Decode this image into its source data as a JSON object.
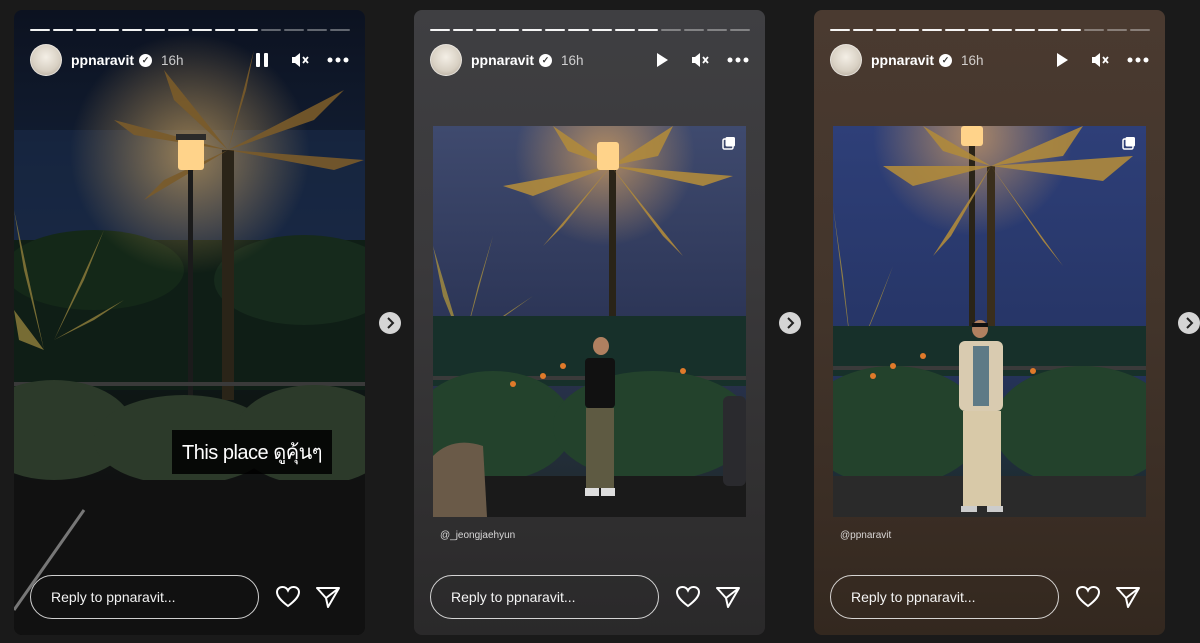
{
  "stories": [
    {
      "username": "ppnaravit",
      "time": "16h",
      "caption": "This place ดูคุ้นๆ",
      "reply_placeholder": "Reply to ppnaravit...",
      "playback": "paused"
    },
    {
      "username": "ppnaravit",
      "time": "16h",
      "mention": "@_jeongjaehyun",
      "reply_placeholder": "Reply to ppnaravit...",
      "playback": "playing"
    },
    {
      "username": "ppnaravit",
      "time": "16h",
      "mention": "@ppnaravit",
      "reply_placeholder": "Reply to ppnaravit...",
      "playback": "playing"
    }
  ],
  "icons": {
    "verified": "verified-badge-icon",
    "pause": "pause-icon",
    "play": "play-icon",
    "mute": "muted-speaker-icon",
    "more": "more-icon",
    "like": "heart-icon",
    "share": "send-icon",
    "next": "chevron-right-icon",
    "multi": "multiple-photos-icon"
  }
}
